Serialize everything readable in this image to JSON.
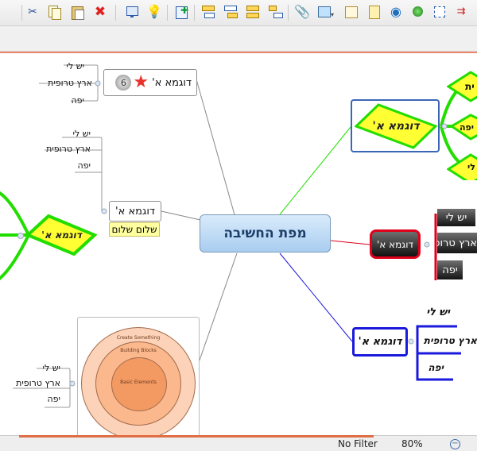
{
  "toolbar": {
    "icons": [
      "cut-icon",
      "copy-icon",
      "paste-icon",
      "delete-icon",
      "presentation-icon",
      "idea-icon",
      "export-icon",
      "topic-icon",
      "subtopic-icon",
      "floating-topic-icon",
      "callout-icon",
      "attachment-icon",
      "image-icon",
      "text-icon",
      "web-link-icon",
      "marker-icon",
      "boundary-icon",
      "relationship-icon"
    ]
  },
  "map": {
    "center_title": "מפת החשיבה",
    "topic_label": "דוגמא א'",
    "topic_label_dark": "דוגמא א'",
    "sub_labels": [
      "יש לי",
      "ארץ טרופית",
      "יפה"
    ],
    "note_text": "שלום שלום",
    "diagram_labels": [
      "Create Something",
      "Building Blocks",
      "Basic Elements"
    ]
  },
  "colors": {
    "accent_green": "#22dd00",
    "accent_blue": "#1a1adc",
    "accent_red": "#e0001a",
    "center_fill": "#b9d8f6"
  },
  "status": {
    "filter": "No Filter",
    "zoom": "80%"
  }
}
